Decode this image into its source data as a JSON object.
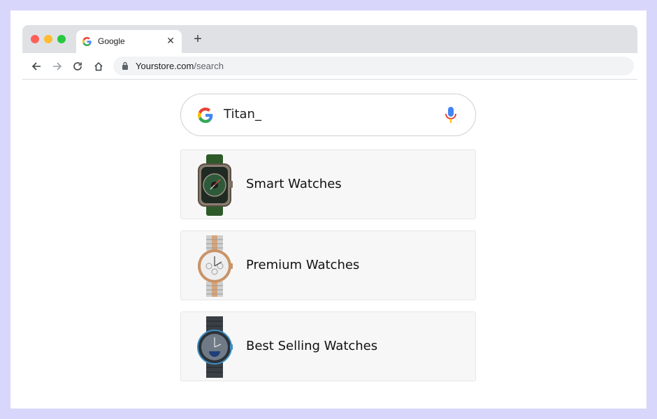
{
  "tab": {
    "title": "Google",
    "close_icon": "close-icon",
    "new_tab_icon": "plus-icon"
  },
  "toolbar": {
    "url_host": "Yourstore.com",
    "url_path": "/search"
  },
  "search": {
    "value": "Titan_",
    "logo_icon": "google-g-icon",
    "mic_icon": "microphone-icon"
  },
  "suggestions": [
    {
      "label": "Smart Watches",
      "image": "green-square-smartwatch"
    },
    {
      "label": "Premium Watches",
      "image": "silver-rose-gold-chronograph"
    },
    {
      "label": "Best Selling Watches",
      "image": "dark-blue-moonphase-watch"
    }
  ],
  "colors": {
    "page_background": "#d8d6fb",
    "tab_strip": "#dfe1e5",
    "card_background": "#f7f7f7"
  }
}
